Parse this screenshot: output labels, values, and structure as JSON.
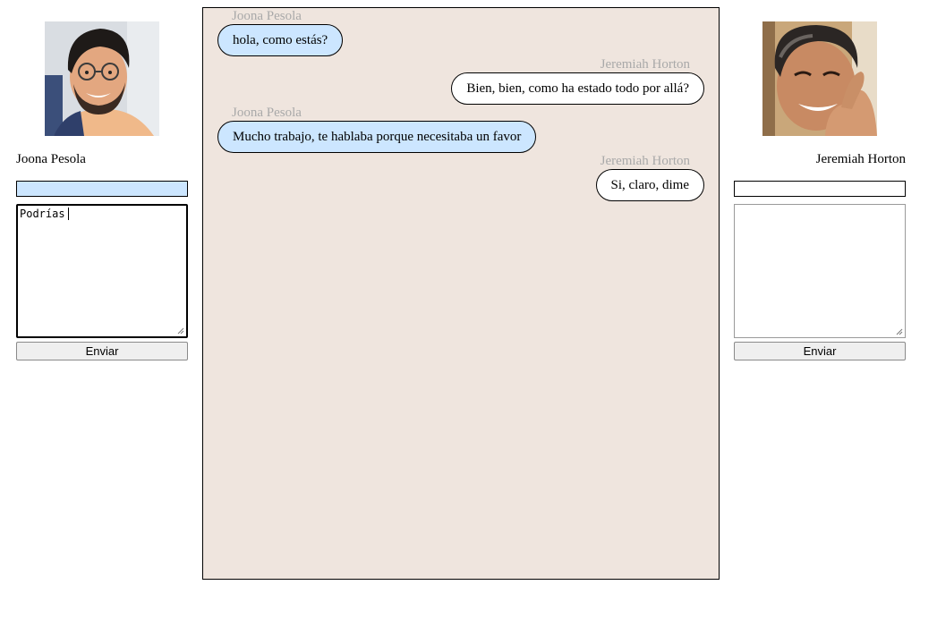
{
  "left_user": {
    "name": "Joona Pesola",
    "avatar_icon": "user-photo-joona",
    "name_input_value": "",
    "message_draft": "Podrías",
    "send_label": "Enviar",
    "bubble_color": "#cce6ff"
  },
  "right_user": {
    "name": "Jeremiah Horton",
    "avatar_icon": "user-photo-jeremiah",
    "name_input_value": "",
    "message_draft": "",
    "send_label": "Enviar",
    "bubble_color": "#ffffff"
  },
  "chat": {
    "background": "#efe5de",
    "messages": [
      {
        "sender": "Joona Pesola",
        "text": "hola, como estás?",
        "side": "left"
      },
      {
        "sender": "Jeremiah Horton",
        "text": "Bien, bien, como ha estado todo por allá?",
        "side": "right"
      },
      {
        "sender": "Joona Pesola",
        "text": "Mucho trabajo, te hablaba porque necesitaba un favor",
        "side": "left"
      },
      {
        "sender": "Jeremiah Horton",
        "text": "Si, claro, dime",
        "side": "right"
      }
    ]
  }
}
